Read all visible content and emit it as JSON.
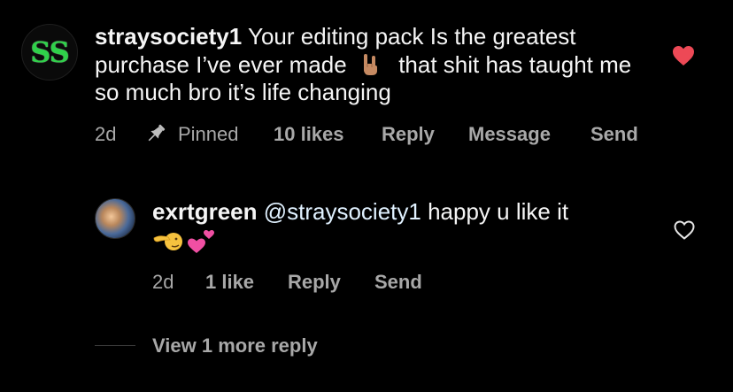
{
  "comment": {
    "username": "straysociety1",
    "text_part1": "Your editing pack Is the greatest purchase I’ve ever made",
    "emoji_name": "sign-of-the-horns-emoji",
    "text_part2": "that shit has taught me so much bro it’s life changing",
    "avatar_initials": "SS",
    "time": "2d",
    "pinned_label": "Pinned",
    "likes": "10 likes",
    "reply_label": "Reply",
    "message_label": "Message",
    "send_label": "Send",
    "liked": true,
    "like_icon": "heart-filled-icon",
    "accent_color": "#ed4956"
  },
  "reply": {
    "username": "exrtgreen",
    "mention": "@straysociety1",
    "text": "happy u like it",
    "emojis": [
      "pointing-hand-emoji",
      "two-hearts-emoji"
    ],
    "time": "2d",
    "likes": "1 like",
    "reply_label": "Reply",
    "send_label": "Send",
    "liked": false,
    "like_icon": "heart-outline-icon"
  },
  "thread": {
    "view_more_label": "View 1 more reply"
  }
}
